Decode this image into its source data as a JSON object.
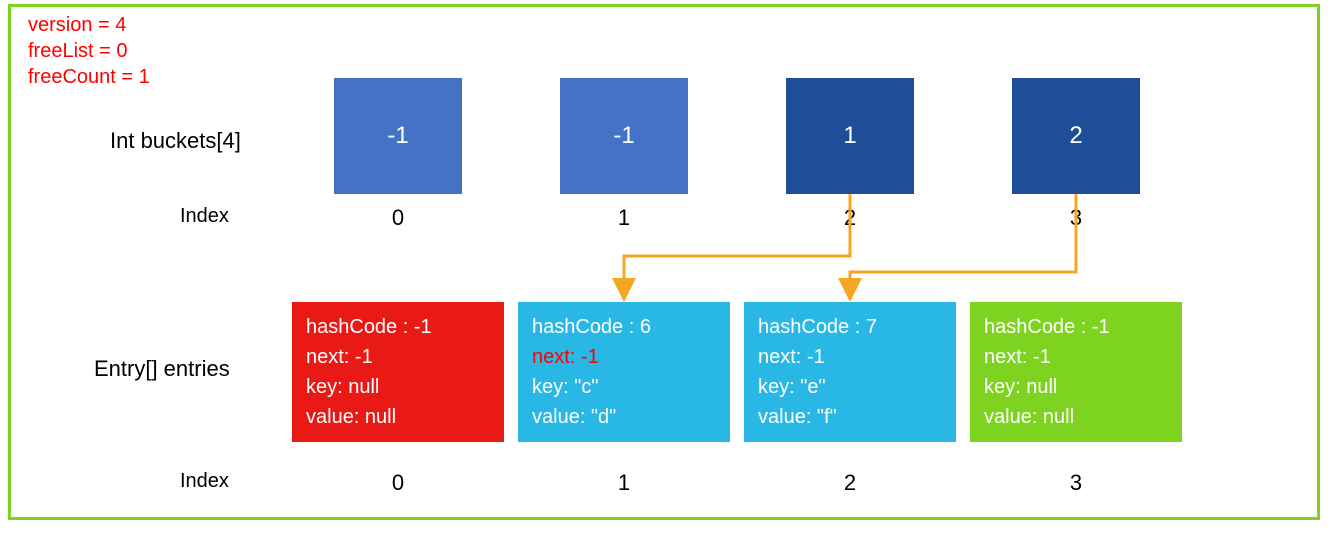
{
  "meta": {
    "version_label": "version = 4",
    "freeList_label": "freeList = 0",
    "freeCount_label": "freeCount = 1"
  },
  "labels": {
    "buckets": "Int buckets[4]",
    "entries": "Entry[] entries",
    "index": "Index"
  },
  "buckets": [
    {
      "value": "-1",
      "shade": "light"
    },
    {
      "value": "-1",
      "shade": "light"
    },
    {
      "value": "1",
      "shade": "dark"
    },
    {
      "value": "2",
      "shade": "dark"
    }
  ],
  "bucket_indices": [
    "0",
    "1",
    "2",
    "3"
  ],
  "entries": [
    {
      "color": "red",
      "hashCode": "hashCode : -1",
      "next": "next: -1",
      "key": "key: null",
      "value": "value: null",
      "next_highlight": false
    },
    {
      "color": "blue",
      "hashCode": "hashCode : 6",
      "next": "next: -1",
      "key": "key: \"c\"",
      "value": "value: \"d\"",
      "next_highlight": true
    },
    {
      "color": "blue",
      "hashCode": "hashCode : 7",
      "next": "next: -1",
      "key": "key: \"e\"",
      "value": "value: \"f\"",
      "next_highlight": false
    },
    {
      "color": "green",
      "hashCode": "hashCode : -1",
      "next": "next: -1",
      "key": "key: null",
      "value": "value: null",
      "next_highlight": false
    }
  ],
  "entry_indices": [
    "0",
    "1",
    "2",
    "3"
  ],
  "arrows": [
    {
      "from_bucket": 2,
      "to_entry": 1
    },
    {
      "from_bucket": 3,
      "to_entry": 2
    }
  ],
  "colors": {
    "arrow": "#F5A623"
  }
}
